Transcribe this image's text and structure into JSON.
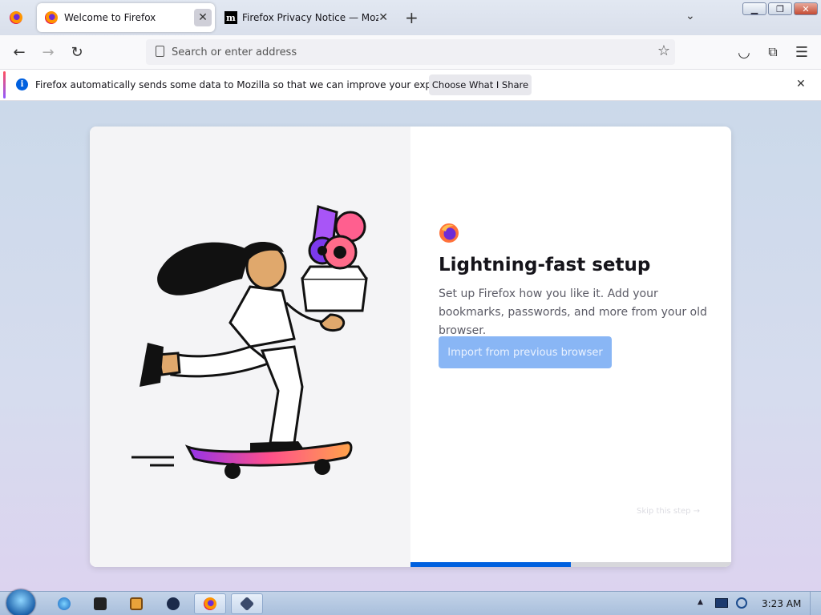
{
  "tabs": [
    {
      "label": "Welcome to Firefox",
      "close": "✕"
    },
    {
      "label": "Firefox Privacy Notice — Mozilla",
      "favicon_letter": "m",
      "close": "✕"
    }
  ],
  "tabstrip": {
    "new_tab": "+",
    "list_all": "⌄"
  },
  "window": {
    "minimize": "▁",
    "maximize": "❐",
    "close": "✕"
  },
  "navbar": {
    "url_placeholder": "Search or enter address",
    "back": "←",
    "forward": "→",
    "reload": "↻",
    "bookmark": "☆",
    "pocket": "◡",
    "extensions": "⧉",
    "menu": "☰"
  },
  "notification": {
    "icon": "i",
    "message": "Firefox automatically sends some data to Mozilla so that we can improve your experience.",
    "button_label": "Choose What I Share",
    "close": "✕"
  },
  "onboarding": {
    "title": "Lightning-fast setup",
    "description": "Set up Firefox how you like it. Add your bookmarks, passwords, and more from your old browser.",
    "primary_button": "Import from previous browser",
    "skip_link": "Skip this step →",
    "progress": 0.5
  },
  "taskbar": {
    "clock": "3:23 AM",
    "items": [
      "start-orb",
      "internet-explorer-icon",
      "app-box-icon",
      "media-player-icon",
      "circle-app-icon",
      "firefox-icon",
      "virtualbox-icon"
    ]
  },
  "colors": {
    "accent": "#0060df",
    "import_button": "#89b6f5"
  }
}
